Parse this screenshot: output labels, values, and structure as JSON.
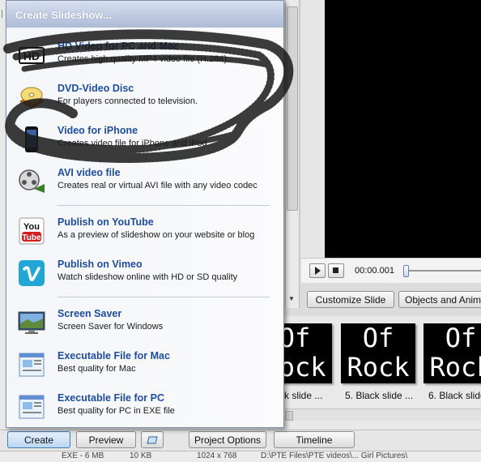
{
  "popup": {
    "title": "Create Slideshow...",
    "items": [
      {
        "title": "HD Video for PC and Mac",
        "desc": "Creates high quality MP4 video file (H.264)",
        "icon": "hd-video-icon"
      },
      {
        "title": "DVD-Video Disc",
        "desc": "For players connected to television.",
        "icon": "dvd-disc-icon"
      },
      {
        "title": "Video for iPhone",
        "desc": "Creates video file for iPhone and iPod",
        "icon": "iphone-icon"
      },
      {
        "title": "AVI video file",
        "desc": "Creates real or virtual AVI file with any video codec",
        "icon": "film-reel-icon"
      },
      {
        "title": "Publish on YouTube",
        "desc": "As a preview of slideshow on your website or blog",
        "icon": "youtube-icon"
      },
      {
        "title": "Publish on Vimeo",
        "desc": "Watch slideshow online with HD or SD quality",
        "icon": "vimeo-icon"
      },
      {
        "title": "Screen Saver",
        "desc": "Screen Saver for Windows",
        "icon": "monitor-icon"
      },
      {
        "title": "Executable File for Mac",
        "desc": "Best quality for Mac",
        "icon": "mac-executable-icon"
      },
      {
        "title": "Executable File for PC",
        "desc": "Best quality for PC in EXE file",
        "icon": "pc-executable-icon"
      }
    ]
  },
  "player": {
    "time": "00:00.001"
  },
  "buttons": {
    "customize_slide": "Customize Slide",
    "objects_animation": "Objects and Anim",
    "create": "Create",
    "preview": "Preview",
    "project_options": "Project Options",
    "timeline": "Timeline"
  },
  "slides": [
    {
      "label": "ck slide ...",
      "line1": "Of",
      "line2": "Rock"
    },
    {
      "label": "5. Black slide ...",
      "line1": "Of",
      "line2": "Rock"
    },
    {
      "label": "6. Black slide",
      "line1": "Of",
      "line2": "Rock"
    }
  ],
  "status": {
    "a": "EXE - 6 MB",
    "b": "10 KB",
    "c": "1024 x 768",
    "d": "D:\\PTE Files\\PTE videos\\... Girl Pictures\\"
  }
}
